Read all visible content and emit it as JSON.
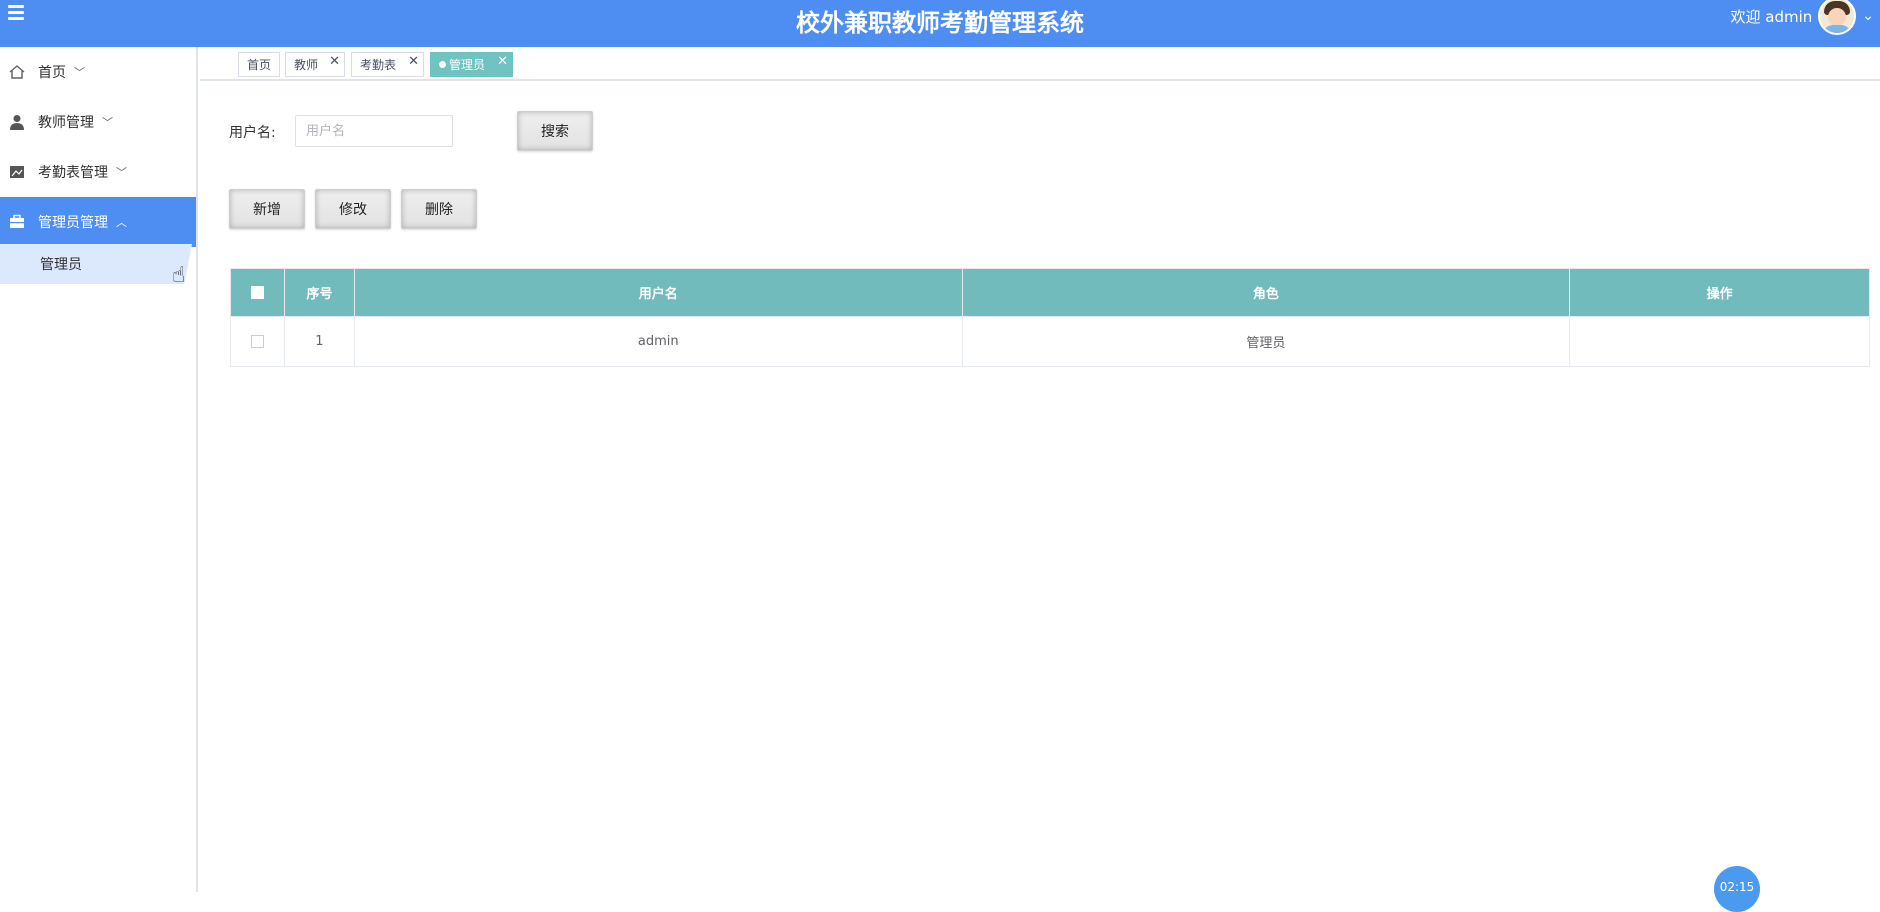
{
  "header": {
    "title": "校外兼职教师考勤管理系统",
    "welcome": "欢迎 admin",
    "brand_color": "#4e8ef2"
  },
  "sidebar": {
    "items": [
      {
        "label": "首页",
        "icon": "home-icon",
        "expanded": false
      },
      {
        "label": "教师管理",
        "icon": "user-icon",
        "expanded": false
      },
      {
        "label": "考勤表管理",
        "icon": "image-icon",
        "expanded": false
      },
      {
        "label": "管理员管理",
        "icon": "briefcase-icon",
        "expanded": true,
        "active": true
      }
    ],
    "sub_items": [
      {
        "label": "管理员"
      }
    ]
  },
  "tabs": [
    {
      "label": "首页",
      "closable": false
    },
    {
      "label": "教师",
      "closable": true
    },
    {
      "label": "考勤表",
      "closable": true
    },
    {
      "label": "管理员",
      "closable": true,
      "active": true
    }
  ],
  "search": {
    "label": "用户名:",
    "placeholder": "用户名",
    "button": "搜索"
  },
  "actions": {
    "add": "新增",
    "edit": "修改",
    "delete": "删除"
  },
  "table": {
    "headers": [
      "序号",
      "用户名",
      "角色",
      "操作"
    ],
    "rows": [
      {
        "index": "1",
        "username": "admin",
        "role": "管理员",
        "ops": ""
      }
    ],
    "header_color": "#72bbbd"
  },
  "timer": "02:15"
}
